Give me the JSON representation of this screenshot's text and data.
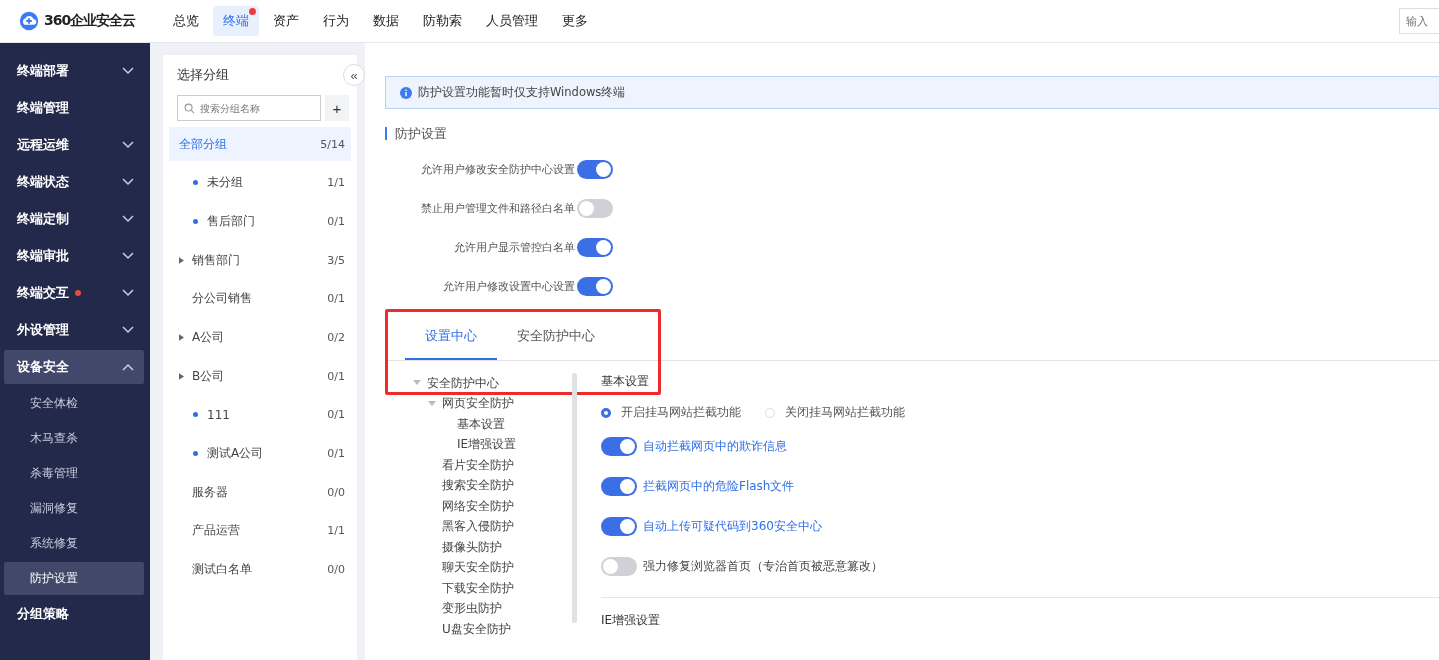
{
  "brand": {
    "name": "360企业安全云"
  },
  "nav": [
    {
      "label": "总览",
      "selected": false,
      "badge": false
    },
    {
      "label": "终端",
      "selected": true,
      "badge": true
    },
    {
      "label": "资产",
      "selected": false,
      "badge": false
    },
    {
      "label": "行为",
      "selected": false,
      "badge": false
    },
    {
      "label": "数据",
      "selected": false,
      "badge": false
    },
    {
      "label": "防勒索",
      "selected": false,
      "badge": false
    },
    {
      "label": "人员管理",
      "selected": false,
      "badge": false
    },
    {
      "label": "更多",
      "selected": false,
      "badge": false
    }
  ],
  "top_search": {
    "placeholder": "输入"
  },
  "sidebar": {
    "items": [
      {
        "label": "终端部署",
        "expandable": true,
        "expanded": false,
        "badge": false,
        "selected": false
      },
      {
        "label": "终端管理",
        "expandable": false,
        "badge": false,
        "selected": false
      },
      {
        "label": "远程运维",
        "expandable": true,
        "expanded": false,
        "badge": false,
        "selected": false
      },
      {
        "label": "终端状态",
        "expandable": true,
        "expanded": false,
        "badge": false,
        "selected": false
      },
      {
        "label": "终端定制",
        "expandable": true,
        "expanded": false,
        "badge": false,
        "selected": false
      },
      {
        "label": "终端审批",
        "expandable": true,
        "expanded": false,
        "badge": false,
        "selected": false
      },
      {
        "label": "终端交互",
        "expandable": true,
        "expanded": false,
        "badge": true,
        "selected": false
      },
      {
        "label": "外设管理",
        "expandable": true,
        "expanded": false,
        "badge": false,
        "selected": false
      },
      {
        "label": "设备安全",
        "expandable": true,
        "expanded": true,
        "badge": false,
        "selected": true,
        "children": [
          {
            "label": "安全体检",
            "selected": false
          },
          {
            "label": "木马查杀",
            "selected": false
          },
          {
            "label": "杀毒管理",
            "selected": false
          },
          {
            "label": "漏洞修复",
            "selected": false
          },
          {
            "label": "系统修复",
            "selected": false
          },
          {
            "label": "防护设置",
            "selected": true
          }
        ]
      },
      {
        "label": "分组策略",
        "expandable": false,
        "badge": false,
        "selected": false
      }
    ]
  },
  "groups": {
    "title": "选择分组",
    "collapse_icon": "«",
    "search": {
      "placeholder": "搜索分组名称"
    },
    "add": "+",
    "items": [
      {
        "kind": "root",
        "label": "全部分组",
        "count": "5/14",
        "selected": true
      },
      {
        "kind": "dot",
        "label": "未分组",
        "count": "1/1",
        "selected": false
      },
      {
        "kind": "dot",
        "label": "售后部门",
        "count": "0/1",
        "selected": false
      },
      {
        "kind": "folder",
        "label": "销售部门",
        "count": "3/5",
        "selected": false
      },
      {
        "kind": "plain",
        "label": "分公司销售",
        "count": "0/1",
        "selected": false
      },
      {
        "kind": "folder",
        "label": "A公司",
        "count": "0/2",
        "selected": false
      },
      {
        "kind": "folder",
        "label": "B公司",
        "count": "0/1",
        "selected": false
      },
      {
        "kind": "dot",
        "label": "111",
        "count": "0/1",
        "selected": false
      },
      {
        "kind": "dot",
        "label": "测试A公司",
        "count": "0/1",
        "selected": false
      },
      {
        "kind": "plain",
        "label": "服务器",
        "count": "0/0",
        "selected": false
      },
      {
        "kind": "plain",
        "label": "产品运营",
        "count": "1/1",
        "selected": false
      },
      {
        "kind": "plain",
        "label": "测试白名单",
        "count": "0/0",
        "selected": false
      }
    ]
  },
  "notice": "防护设置功能暂时仅支持Windows终端",
  "section_title": "防护设置",
  "switches": [
    {
      "label": "允许用户修改安全防护中心设置",
      "on": true
    },
    {
      "label": "禁止用户管理文件和路径白名单",
      "on": false
    },
    {
      "label": "允许用户显示管控白名单",
      "on": true
    },
    {
      "label": "允许用户修改设置中心设置",
      "on": true
    }
  ],
  "tabs": [
    {
      "label": "设置中心",
      "selected": true
    },
    {
      "label": "安全防护中心",
      "selected": false
    }
  ],
  "tree": [
    {
      "label": "安全防护中心",
      "expanded": true,
      "children": [
        {
          "label": "网页安全防护",
          "expanded": true,
          "children": [
            {
              "label": "基本设置"
            },
            {
              "label": "IE增强设置"
            }
          ]
        },
        {
          "label": "看片安全防护"
        },
        {
          "label": "搜索安全防护"
        },
        {
          "label": "网络安全防护"
        },
        {
          "label": "黑客入侵防护"
        },
        {
          "label": "摄像头防护"
        },
        {
          "label": "聊天安全防护"
        },
        {
          "label": "下载安全防护"
        },
        {
          "label": "变形虫防护"
        },
        {
          "label": "U盘安全防护"
        }
      ]
    }
  ],
  "basic": {
    "title": "基本设置",
    "radios": [
      {
        "label": "开启挂马网站拦截功能",
        "selected": true
      },
      {
        "label": "关闭挂马网站拦截功能",
        "selected": false
      }
    ],
    "options": [
      {
        "label": "自动拦截网页中的欺诈信息",
        "on": true
      },
      {
        "label": "拦截网页中的危险Flash文件",
        "on": true
      },
      {
        "label": "自动上传可疑代码到360安全中心",
        "on": true
      },
      {
        "label": "强力修复浏览器首页（专治首页被恶意篡改）",
        "on": false
      }
    ]
  },
  "next_section": "IE增强设置"
}
